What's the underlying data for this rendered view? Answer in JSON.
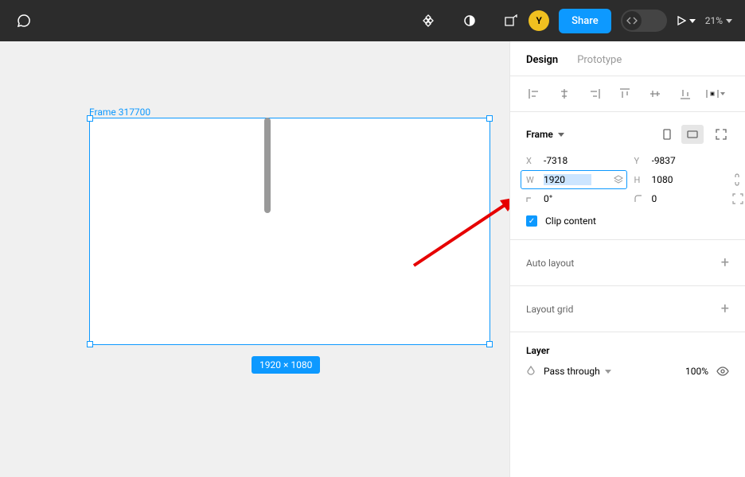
{
  "toolbar": {
    "avatar_letter": "Y",
    "share_label": "Share",
    "zoom": "21%"
  },
  "canvas": {
    "frame_label": "Frame 317700",
    "dim_badge": "1920 × 1080"
  },
  "panel": {
    "tabs": {
      "design": "Design",
      "prototype": "Prototype"
    },
    "frame": {
      "title": "Frame",
      "x_label": "X",
      "x": "-7318",
      "y_label": "Y",
      "y": "-9837",
      "w_label": "W",
      "w": "1920",
      "h_label": "H",
      "h": "1080",
      "r_label": "⌐",
      "r": "0°",
      "c_label": "⌐",
      "c": "0",
      "clip_label": "Clip content"
    },
    "auto_layout": "Auto layout",
    "layout_grid": "Layout grid",
    "layer": {
      "title": "Layer",
      "blend": "Pass through",
      "opacity": "100%"
    }
  }
}
